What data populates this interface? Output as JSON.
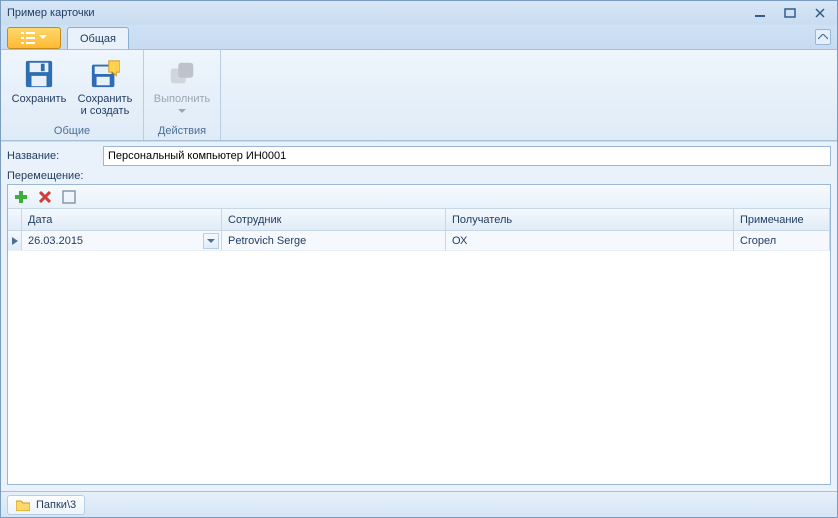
{
  "window": {
    "title": "Пример карточки"
  },
  "ribbon": {
    "tab_label": "Общая",
    "groups": {
      "general": {
        "label": "Общие",
        "save": "Сохранить",
        "save_create_l1": "Сохранить",
        "save_create_l2": "и создать"
      },
      "actions": {
        "label": "Действия",
        "execute": "Выполнить"
      }
    }
  },
  "form": {
    "name_label": "Название:",
    "name_value": "Персональный компьютер ИН0001",
    "move_label": "Перемещение:"
  },
  "grid": {
    "columns": {
      "date": "Дата",
      "employee": "Сотрудник",
      "recipient": "Получатель",
      "note": "Примечание"
    },
    "rows": [
      {
        "date": "26.03.2015",
        "employee": "Petrovich Serge",
        "recipient": "ОХ",
        "note": "Сгорел"
      }
    ]
  },
  "status": {
    "path": "Папки\\3"
  }
}
